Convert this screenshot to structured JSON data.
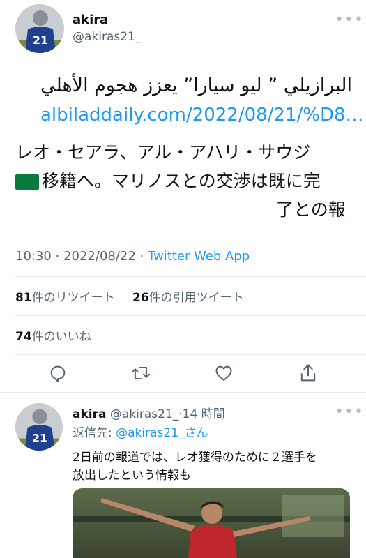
{
  "tweet": {
    "author": {
      "display_name": "akira",
      "handle": "@akiras21_"
    },
    "body": {
      "arabic_line": "البرازيلي ” ليو سيارا” يعزز هجوم الأهلي",
      "link": "albiladdaily.com/2022/08/21/%D8…",
      "jp_line1": "レオ・セアラ、アル・アハリ・サウジ",
      "flag_emoji": "🇸🇦",
      "jp_line2": "移籍へ。マリノスとの交渉は既に完",
      "jp_line3": "了との報"
    },
    "meta": {
      "time": "10:30",
      "sep1": "·",
      "date": "2022/08/22",
      "sep2": "·",
      "source": "Twitter Web App"
    },
    "stats": {
      "retweets": {
        "count": "81",
        "label": "件のリツイート"
      },
      "quotes": {
        "count": "26",
        "label": "件の引用ツイート"
      },
      "likes": {
        "count": "74",
        "label": "件のいいね"
      }
    },
    "actions": [
      "reply-icon",
      "retweet-icon",
      "like-icon",
      "share-icon"
    ],
    "avatar_number": "21"
  },
  "reply": {
    "author": {
      "display_name": "akira",
      "handle": "@akiras21_",
      "time_sep": "·",
      "time": "14 時間"
    },
    "replying_to_label": "返信先:",
    "replying_to_handle": "@akiras21_さん",
    "text_line1": "2日前の報道では、レオ獲得のために２選手を",
    "text_line2": "放出したという情報も",
    "avatar_number": "21"
  },
  "colors": {
    "link": "#1d9bf0",
    "secondary_text": "#536471",
    "divider": "#e6ecf0"
  }
}
